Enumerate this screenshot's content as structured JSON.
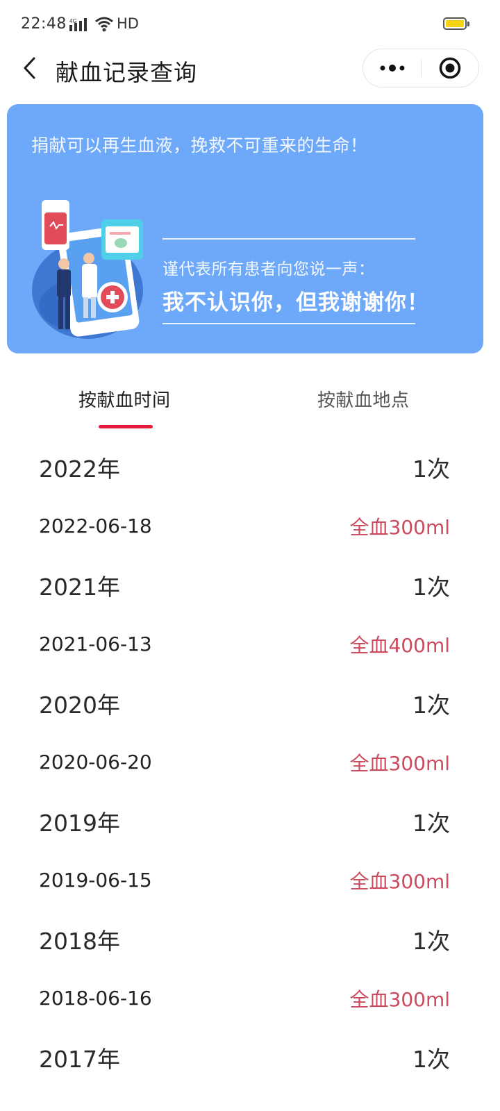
{
  "status_bar": {
    "time": "22:48",
    "network": "4G",
    "hd": "HD",
    "battery_color": "#f4d414"
  },
  "nav": {
    "back_icon": "chevron-left-icon",
    "title": "献血记录查询",
    "more_icon": "more-dots-icon",
    "close_icon": "target-circle-icon"
  },
  "banner": {
    "background": "#6ea8f8",
    "slogan": "捐献可以再生血液，挽救不可重来的生命！",
    "sub_text": "谨代表所有患者向您说一声：",
    "main_text": "我不认识你，但我谢谢你！"
  },
  "tabs": [
    {
      "label": "按献血时间",
      "active": true
    },
    {
      "label": "按献血地点",
      "active": false
    }
  ],
  "accent_color": "#e51c3c",
  "amount_color": "#cc4a5e",
  "records": [
    {
      "year": "2022年",
      "count": "1次",
      "entries": [
        {
          "date": "2022-06-18",
          "amount": "全血300ml"
        }
      ]
    },
    {
      "year": "2021年",
      "count": "1次",
      "entries": [
        {
          "date": "2021-06-13",
          "amount": "全血400ml"
        }
      ]
    },
    {
      "year": "2020年",
      "count": "1次",
      "entries": [
        {
          "date": "2020-06-20",
          "amount": "全血300ml"
        }
      ]
    },
    {
      "year": "2019年",
      "count": "1次",
      "entries": [
        {
          "date": "2019-06-15",
          "amount": "全血300ml"
        }
      ]
    },
    {
      "year": "2018年",
      "count": "1次",
      "entries": [
        {
          "date": "2018-06-16",
          "amount": "全血300ml"
        }
      ]
    },
    {
      "year": "2017年",
      "count": "1次",
      "entries": []
    }
  ]
}
